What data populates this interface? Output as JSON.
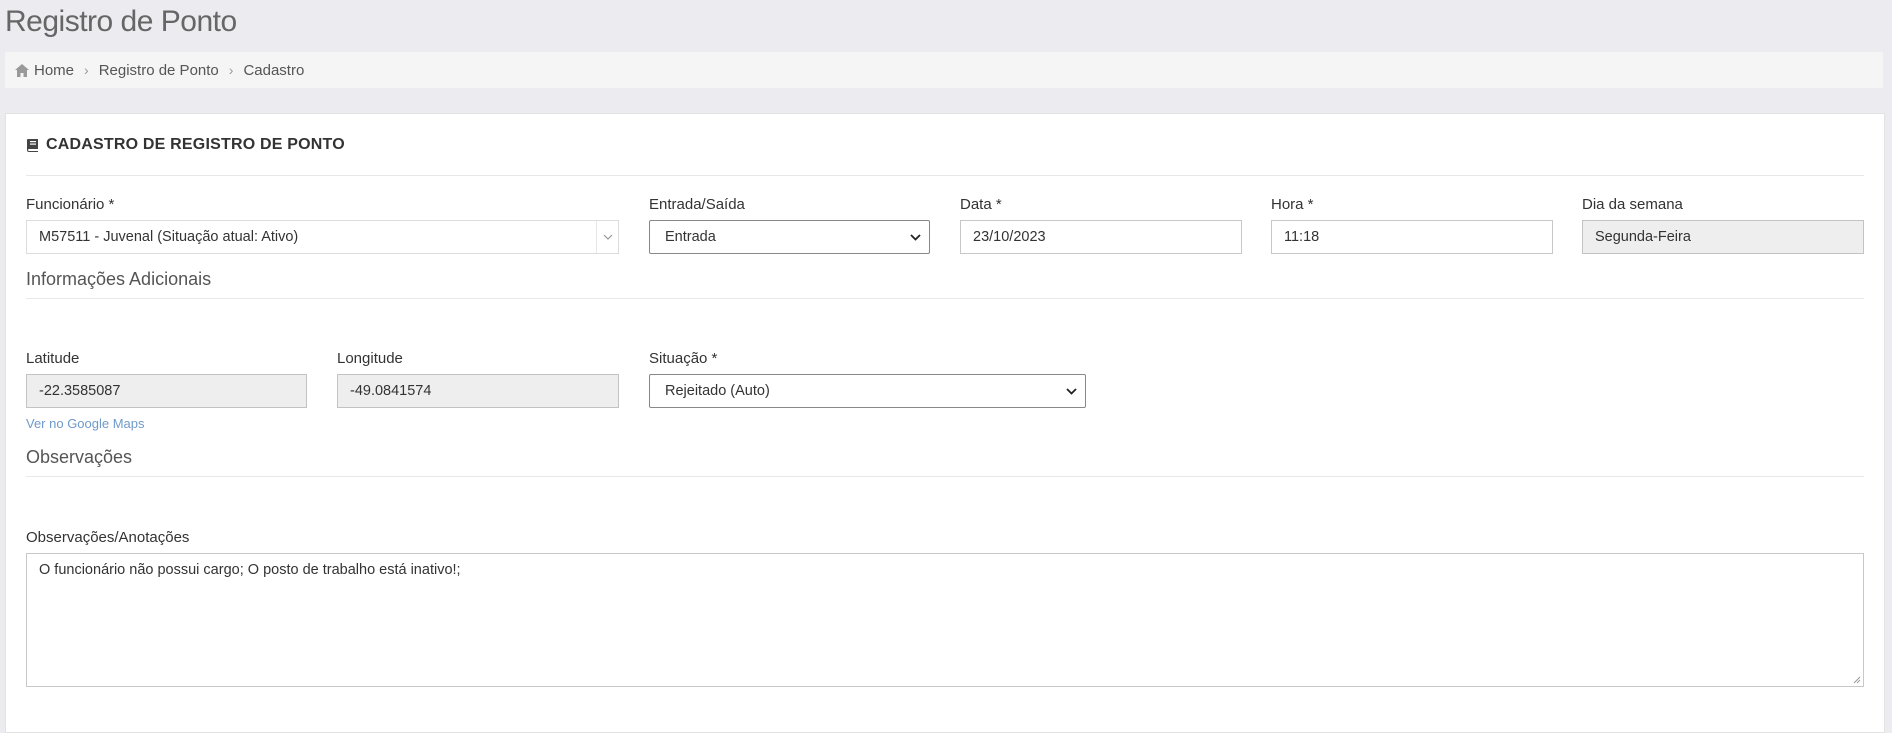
{
  "page": {
    "title": "Registro de Ponto"
  },
  "breadcrumb": {
    "icon": "home-icon",
    "items": [
      "Home",
      "Registro de Ponto",
      "Cadastro"
    ]
  },
  "card": {
    "icon": "book-icon",
    "title": "CADASTRO DE REGISTRO DE PONTO"
  },
  "form": {
    "funcionario": {
      "label": "Funcionário *",
      "value": "M57511 - Juvenal (Situação atual: Ativo)"
    },
    "entrada_saida": {
      "label": "Entrada/Saída",
      "value": "Entrada"
    },
    "data": {
      "label": "Data *",
      "value": "23/10/2023"
    },
    "hora": {
      "label": "Hora *",
      "value": "11:18"
    },
    "dia_semana": {
      "label": "Dia da semana",
      "value": "Segunda-Feira"
    }
  },
  "info": {
    "section_title": "Informações Adicionais",
    "latitude": {
      "label": "Latitude",
      "value": "-22.3585087"
    },
    "longitude": {
      "label": "Longitude",
      "value": "-49.0841574"
    },
    "maps_link": "Ver no Google Maps",
    "situacao": {
      "label": "Situação *",
      "value": "Rejeitado (Auto)"
    }
  },
  "obs": {
    "section_title": "Observações",
    "label": "Observações/Anotações",
    "value": "O funcionário não possui cargo; O posto de trabalho está inativo!;"
  },
  "colors": {
    "link": "#6f9ac9",
    "background": "#ebebf0",
    "readonly": "#eeeeee"
  }
}
